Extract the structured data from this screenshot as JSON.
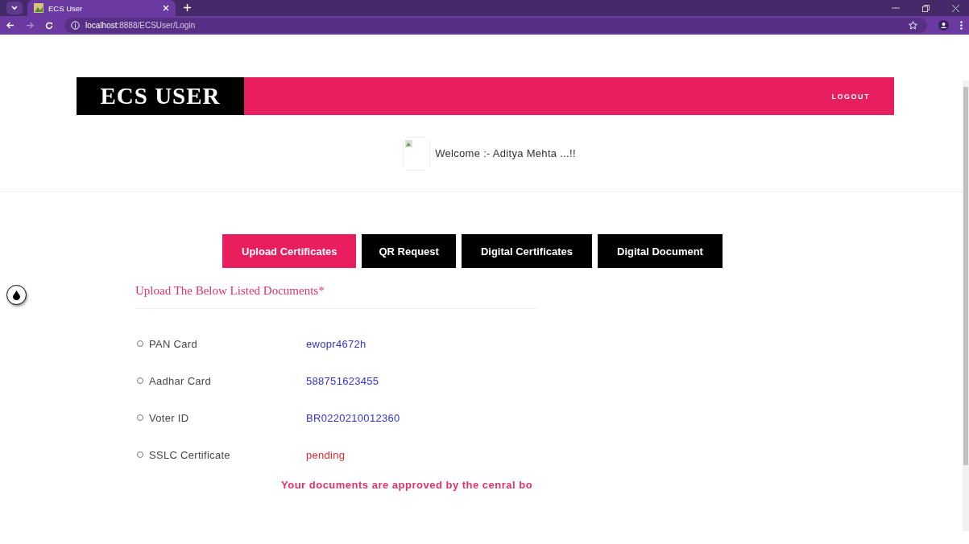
{
  "browser": {
    "tab_title": "ECS User",
    "url_host": "localhost",
    "url_path": ":8888/ECSUser/Login"
  },
  "header": {
    "logo": "ECS USER",
    "logout": "LOGOUT"
  },
  "welcome": "Welcome :- Aditya Mehta ...!!",
  "tabs": [
    {
      "label": "Upload Certificates",
      "selected": true
    },
    {
      "label": "QR Request",
      "selected": false
    },
    {
      "label": "Digital Certificates",
      "selected": false
    },
    {
      "label": "Digital Document",
      "selected": false
    }
  ],
  "heading": "Upload The Below Listed Documents*",
  "documents": [
    {
      "name": "PAN Card",
      "value": "ewopr4672h",
      "color": "#3333cc",
      "checked": false
    },
    {
      "name": "Aadhar Card",
      "value": "588751623455",
      "color": "#3333cc",
      "checked": false
    },
    {
      "name": "Voter ID",
      "value": "BR0220210012360",
      "color": "#3333cc",
      "checked": false
    },
    {
      "name": "SSLC Certificate",
      "value": "pending",
      "color": "#e8262e",
      "checked": false
    }
  ],
  "message": "Your documents are approved by the cenral bo"
}
